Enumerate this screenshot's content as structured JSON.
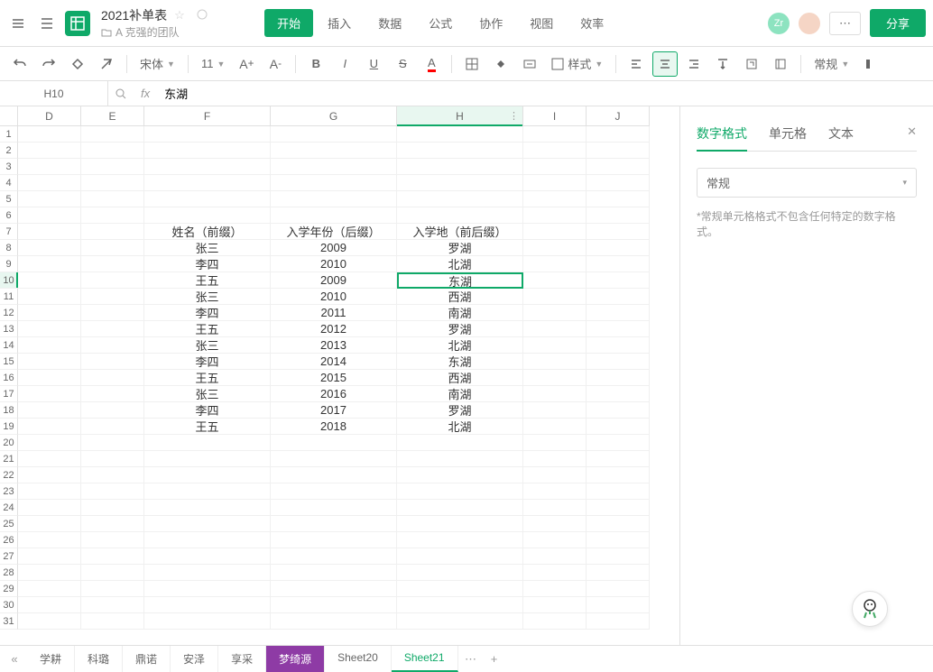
{
  "header": {
    "title": "2021补单表",
    "folder": "A 克强的团队",
    "tabs": [
      "开始",
      "插入",
      "数据",
      "公式",
      "协作",
      "视图",
      "效率"
    ],
    "active_tab": 0,
    "avatar_text": "Zr",
    "more": "⋯",
    "share": "分享"
  },
  "toolbar": {
    "font": "宋体",
    "size": "11",
    "style_label": "样式",
    "format_label": "常规"
  },
  "formula": {
    "cell": "H10",
    "value": "东湖"
  },
  "columns": [
    "D",
    "E",
    "F",
    "G",
    "H",
    "I",
    "J"
  ],
  "selected_col": 4,
  "selected_row": 10,
  "rows": [
    {
      "n": 1,
      "cells": [
        "",
        "",
        "",
        "",
        "",
        "",
        ""
      ]
    },
    {
      "n": 2,
      "cells": [
        "",
        "",
        "",
        "",
        "",
        "",
        ""
      ]
    },
    {
      "n": 3,
      "cells": [
        "",
        "",
        "",
        "",
        "",
        "",
        ""
      ]
    },
    {
      "n": 4,
      "cells": [
        "",
        "",
        "",
        "",
        "",
        "",
        ""
      ]
    },
    {
      "n": 5,
      "cells": [
        "",
        "",
        "",
        "",
        "",
        "",
        ""
      ]
    },
    {
      "n": 6,
      "cells": [
        "",
        "",
        "",
        "",
        "",
        "",
        ""
      ]
    },
    {
      "n": 7,
      "cells": [
        "",
        "",
        "姓名（前缀）",
        "入学年份（后缀）",
        "入学地（前后缀）",
        "",
        ""
      ]
    },
    {
      "n": 8,
      "cells": [
        "",
        "",
        "张三",
        "2009",
        "罗湖",
        "",
        ""
      ]
    },
    {
      "n": 9,
      "cells": [
        "",
        "",
        "李四",
        "2010",
        "北湖",
        "",
        ""
      ]
    },
    {
      "n": 10,
      "cells": [
        "",
        "",
        "王五",
        "2009",
        "东湖",
        "",
        ""
      ]
    },
    {
      "n": 11,
      "cells": [
        "",
        "",
        "张三",
        "2010",
        "西湖",
        "",
        ""
      ]
    },
    {
      "n": 12,
      "cells": [
        "",
        "",
        "李四",
        "2011",
        "南湖",
        "",
        ""
      ]
    },
    {
      "n": 13,
      "cells": [
        "",
        "",
        "王五",
        "2012",
        "罗湖",
        "",
        ""
      ]
    },
    {
      "n": 14,
      "cells": [
        "",
        "",
        "张三",
        "2013",
        "北湖",
        "",
        ""
      ]
    },
    {
      "n": 15,
      "cells": [
        "",
        "",
        "李四",
        "2014",
        "东湖",
        "",
        ""
      ]
    },
    {
      "n": 16,
      "cells": [
        "",
        "",
        "王五",
        "2015",
        "西湖",
        "",
        ""
      ]
    },
    {
      "n": 17,
      "cells": [
        "",
        "",
        "张三",
        "2016",
        "南湖",
        "",
        ""
      ]
    },
    {
      "n": 18,
      "cells": [
        "",
        "",
        "李四",
        "2017",
        "罗湖",
        "",
        ""
      ]
    },
    {
      "n": 19,
      "cells": [
        "",
        "",
        "王五",
        "2018",
        "北湖",
        "",
        ""
      ]
    },
    {
      "n": 20,
      "cells": [
        "",
        "",
        "",
        "",
        "",
        "",
        ""
      ]
    },
    {
      "n": 21,
      "cells": [
        "",
        "",
        "",
        "",
        "",
        "",
        ""
      ]
    },
    {
      "n": 22,
      "cells": [
        "",
        "",
        "",
        "",
        "",
        "",
        ""
      ]
    },
    {
      "n": 23,
      "cells": [
        "",
        "",
        "",
        "",
        "",
        "",
        ""
      ]
    },
    {
      "n": 24,
      "cells": [
        "",
        "",
        "",
        "",
        "",
        "",
        ""
      ]
    },
    {
      "n": 25,
      "cells": [
        "",
        "",
        "",
        "",
        "",
        "",
        ""
      ]
    },
    {
      "n": 26,
      "cells": [
        "",
        "",
        "",
        "",
        "",
        "",
        ""
      ]
    },
    {
      "n": 27,
      "cells": [
        "",
        "",
        "",
        "",
        "",
        "",
        ""
      ]
    },
    {
      "n": 28,
      "cells": [
        "",
        "",
        "",
        "",
        "",
        "",
        ""
      ]
    },
    {
      "n": 29,
      "cells": [
        "",
        "",
        "",
        "",
        "",
        "",
        ""
      ]
    },
    {
      "n": 30,
      "cells": [
        "",
        "",
        "",
        "",
        "",
        "",
        ""
      ]
    },
    {
      "n": 31,
      "cells": [
        "",
        "",
        "",
        "",
        "",
        "",
        ""
      ]
    }
  ],
  "panel": {
    "tabs": [
      "数字格式",
      "单元格",
      "文本"
    ],
    "active": 0,
    "format_value": "常规",
    "hint": "*常规单元格格式不包含任何特定的数字格式。"
  },
  "sheets": {
    "items": [
      "学耕",
      "科璐",
      "鼎诺",
      "安泽",
      "享采",
      "梦绮源",
      "Sheet20",
      "Sheet21"
    ],
    "purple": 5,
    "active": 7
  }
}
